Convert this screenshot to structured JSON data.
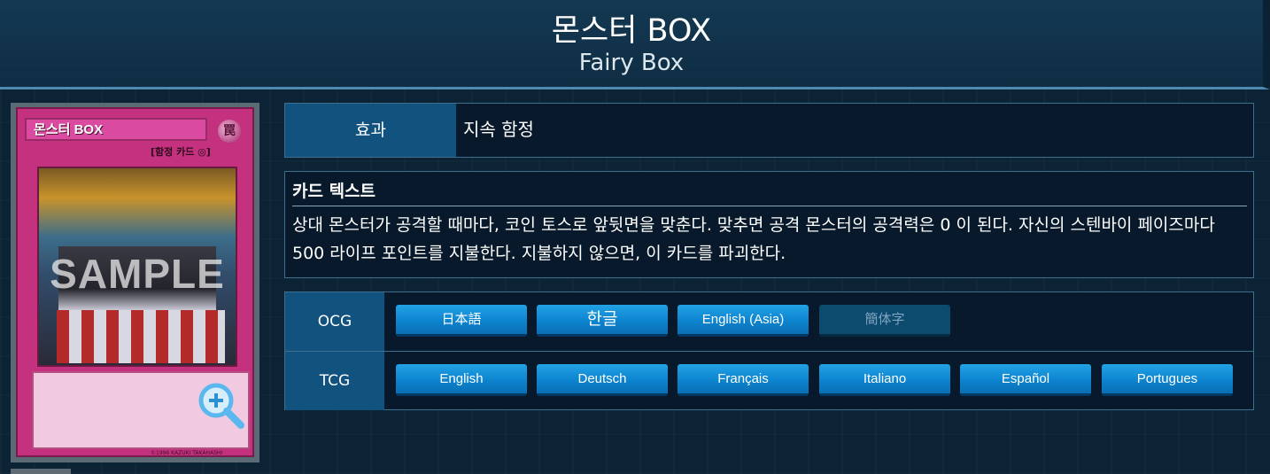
{
  "header": {
    "title": "몬스터 BOX",
    "subtitle": "Fairy Box"
  },
  "card_image": {
    "name": "몬스터 BOX",
    "type_line": "[함정 카드 ◎]",
    "attribute": "罠",
    "watermark": "SAMPLE",
    "copyright": "©1996 KAZUKI TAKAHASHI",
    "zoom_icon": "zoom-in-icon"
  },
  "effect": {
    "label": "효과",
    "value": "지속 함정"
  },
  "card_text": {
    "title": "카드 텍스트",
    "body": "상대 몬스터가 공격할 때마다, 코인 토스로 앞뒷면을 맞춘다. 맞추면 공격 몬스터의 공격력은 0 이 된다. 자신의 스텐바이 페이즈마다 500 라이프 포인트를 지불한다. 지불하지 않으면, 이 카드를 파괴한다."
  },
  "languages": {
    "ocg": {
      "label": "OCG",
      "buttons": [
        {
          "label": "日本語",
          "state": "normal"
        },
        {
          "label": "한글",
          "state": "selected"
        },
        {
          "label": "English (Asia)",
          "state": "normal"
        },
        {
          "label": "簡体字",
          "state": "disabled"
        }
      ]
    },
    "tcg": {
      "label": "TCG",
      "buttons": [
        {
          "label": "English"
        },
        {
          "label": "Deutsch"
        },
        {
          "label": "Français"
        },
        {
          "label": "Italiano"
        },
        {
          "label": "Español"
        },
        {
          "label": "Portugues"
        }
      ]
    }
  },
  "colors": {
    "background": "#0a2233",
    "header_accent": "#4f8bb0",
    "label_cell": "#12527f",
    "button": "#0d84cf",
    "button_disabled": "#0c4a6e",
    "trap_card": "#c4317f"
  }
}
